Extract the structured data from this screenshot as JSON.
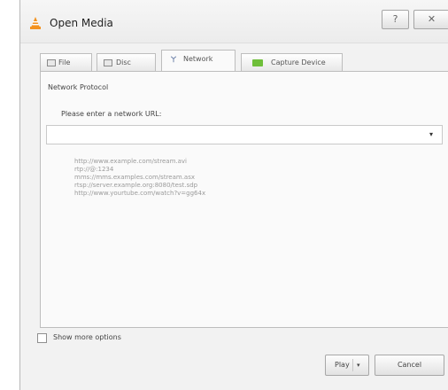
{
  "window": {
    "title": "Open Media",
    "help_glyph": "?",
    "close_glyph": "✕"
  },
  "tabs": [
    {
      "label": "File",
      "icon": "file-icon",
      "active": false
    },
    {
      "label": "Disc",
      "icon": "disc-icon",
      "active": false
    },
    {
      "label": "Network",
      "icon": "network-icon",
      "active": true
    },
    {
      "label": "Capture Device",
      "icon": "capture-device-icon",
      "active": false
    }
  ],
  "network": {
    "group_label": "Network Protocol",
    "url_label": "Please enter a network URL:",
    "url_value": "",
    "dropdown_glyph": "▾",
    "examples": [
      "http://www.example.com/stream.avi",
      "rtp://@:1234",
      "mms://mms.examples.com/stream.asx",
      "rtsp://server.example.org:8080/test.sdp",
      "http://www.yourtube.com/watch?v=gg64x"
    ]
  },
  "options": {
    "show_more_label": "Show more options",
    "checked": false
  },
  "buttons": {
    "play_label": "Play",
    "play_arrow": "▾",
    "cancel_label": "Cancel"
  },
  "colors": {
    "vlc_orange": "#f39220",
    "capture_green": "#6fbf3a"
  }
}
